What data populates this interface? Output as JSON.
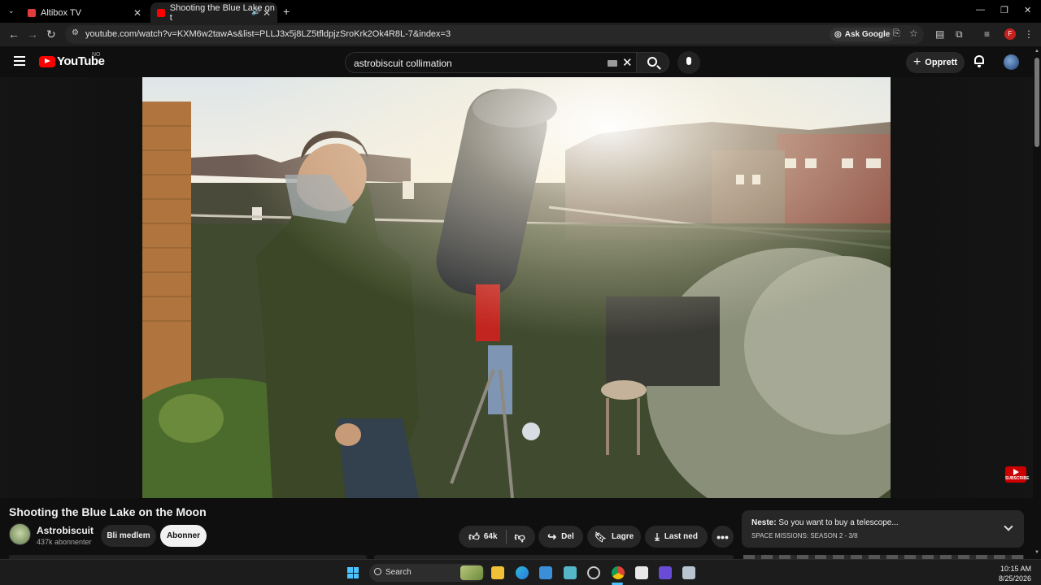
{
  "browser": {
    "tabs": [
      {
        "title": "Altibox TV",
        "active": false
      },
      {
        "title": "Shooting the Blue Lake on t",
        "active": true
      }
    ],
    "url": "youtube.com/watch?v=KXM6w2tawAs&list=PLLJ3x5j8LZ5tfldpjzSroKrk2Ok4R8L-7&index=3",
    "ask_google_label": "Ask Google",
    "profile_initial": "F"
  },
  "youtube": {
    "logo_text": "YouTube",
    "country_code": "NO",
    "search_value": "astrobiscuit collimation",
    "create_label": "Opprett",
    "subscribe_watermark": "SUBSCRIBE"
  },
  "video": {
    "title": "Shooting the Blue Lake on the Moon",
    "channel_name": "Astrobiscuit",
    "channel_subs": "437k abonnenter",
    "join_label": "Bli medlem",
    "subscribe_label": "Abonner",
    "likes": "64k",
    "share_label": "Del",
    "save_label": "Lagre",
    "download_label": "Last ned",
    "more_label": "•••"
  },
  "next_up": {
    "prefix": "Neste:",
    "title": "So you want to buy a telescope...",
    "playlist": "SPACE MISSIONS: SEASON 2 - 3/8"
  },
  "taskbar": {
    "search_label": "Search",
    "time": "10:15 AM",
    "date": "8/25/2026"
  },
  "colors": {
    "youtube_red": "#ff0000",
    "background": "#0f0f0f",
    "pill": "#272727",
    "accent": "#4cc2ff"
  }
}
